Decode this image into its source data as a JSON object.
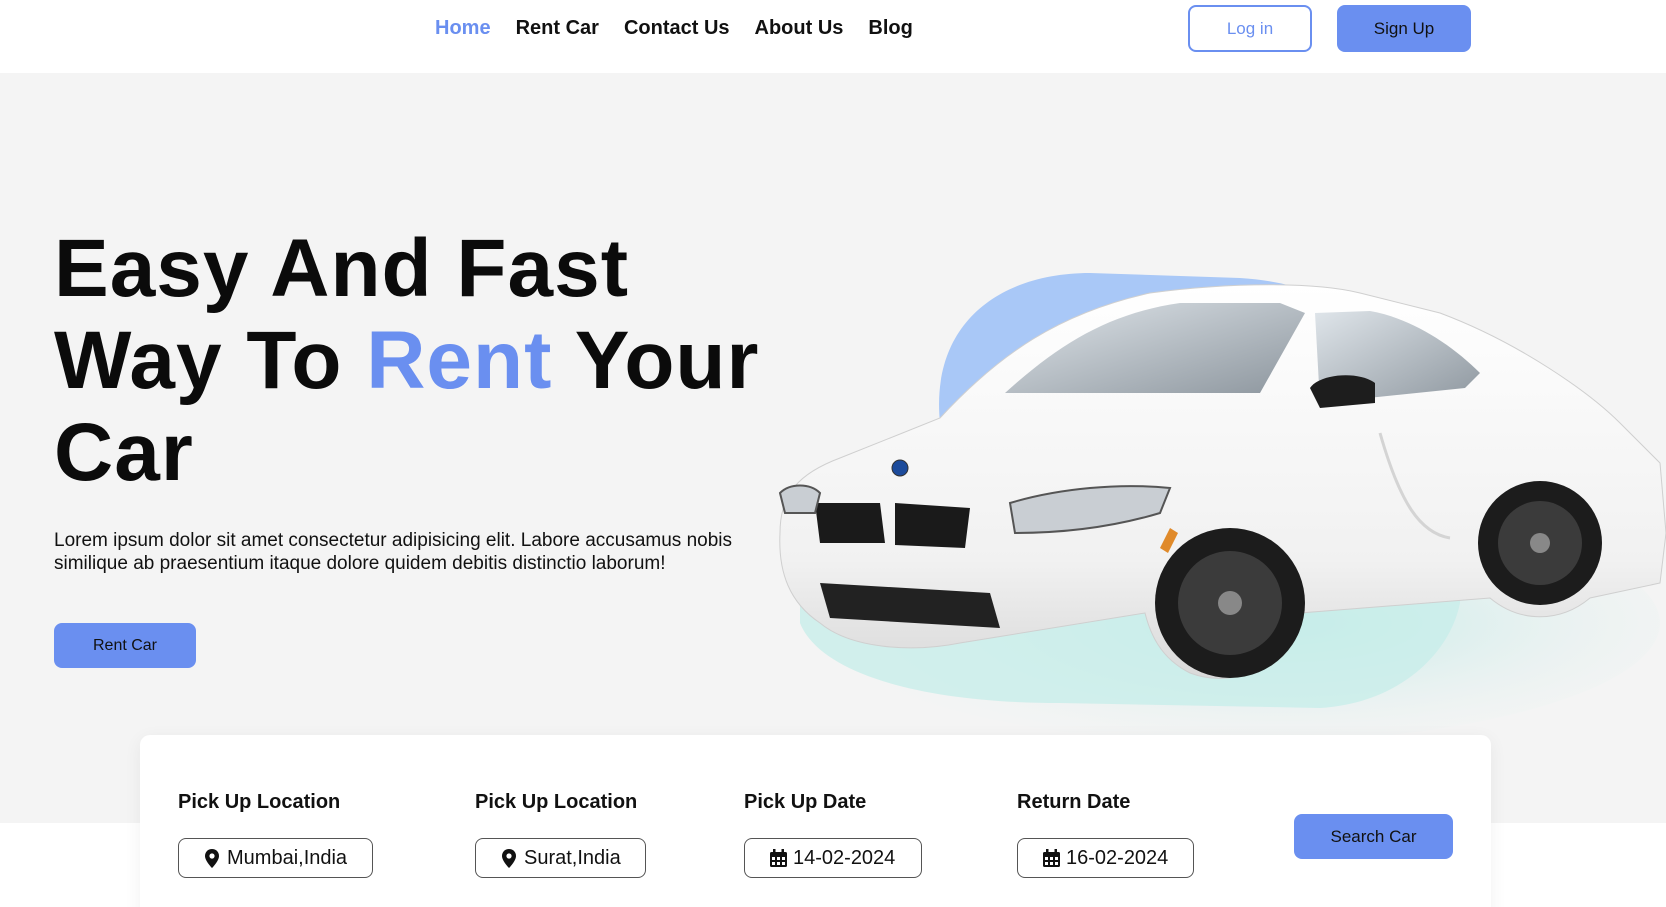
{
  "nav": {
    "items": [
      {
        "label": "Home",
        "active": true
      },
      {
        "label": "Rent Car",
        "active": false
      },
      {
        "label": "Contact Us",
        "active": false
      },
      {
        "label": "About Us",
        "active": false
      },
      {
        "label": "Blog",
        "active": false
      }
    ],
    "login_label": "Log in",
    "signup_label": "Sign Up"
  },
  "hero": {
    "title_line1": "Easy And Fast",
    "title_line2_before": "Way To ",
    "title_line2_accent": "Rent",
    "title_line2_after": " Your",
    "title_line3": "Car",
    "description": "Lorem ipsum dolor sit amet consectetur adipisicing elit. Labore accusamus nobis similique ab praesentium itaque dolore quidem debitis distinctio laborum!",
    "cta_label": "Rent Car"
  },
  "search": {
    "fields": [
      {
        "label": "Pick Up Location",
        "value": "Mumbai,India",
        "icon": "location-pin-icon"
      },
      {
        "label": "Pick Up Location",
        "value": "Surat,India",
        "icon": "location-pin-icon"
      },
      {
        "label": "Pick Up Date",
        "value": "14-02-2024",
        "icon": "calendar-icon"
      },
      {
        "label": "Return Date",
        "value": "16-02-2024",
        "icon": "calendar-icon"
      }
    ],
    "button_label": "Search Car"
  },
  "colors": {
    "accent": "#6a8ff0",
    "hero_bg": "#f4f4f4",
    "blob": "#a9c8f7",
    "blob_teal": "#c3ece8"
  }
}
